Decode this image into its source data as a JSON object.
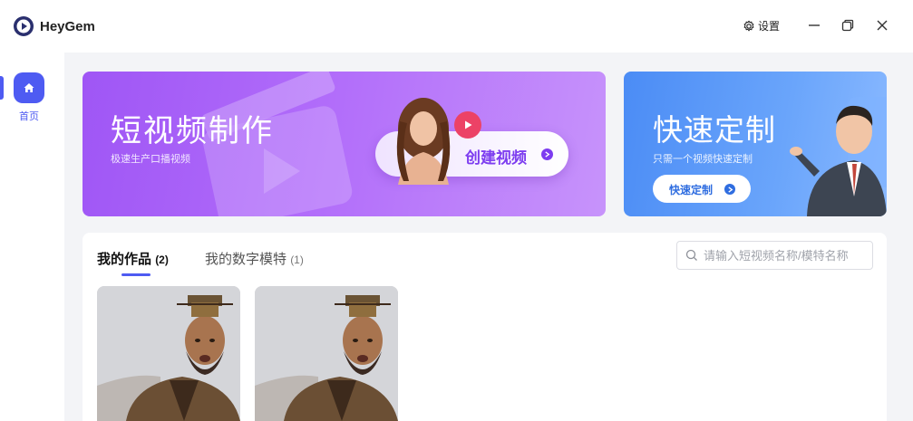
{
  "app": {
    "name": "HeyGem"
  },
  "titlebar": {
    "settings_label": "设置"
  },
  "sidebar": {
    "items": [
      {
        "label": "首页",
        "icon": "home-icon",
        "active": true
      }
    ]
  },
  "banners": {
    "left": {
      "title": "短视频制作",
      "subtitle": "极速生产口播视频",
      "button_label": "创建视频"
    },
    "right": {
      "title": "快速定制",
      "subtitle": "只需一个视频快速定制",
      "button_label": "快速定制"
    }
  },
  "works": {
    "tabs": [
      {
        "label": "我的作品",
        "count": "(2)",
        "active": true
      },
      {
        "label": "我的数字模特",
        "count": "(1)",
        "active": false
      }
    ],
    "search": {
      "placeholder": "请输入短视频名称/模特名称",
      "value": ""
    },
    "cards": [
      {
        "thumbnail": "video-thumbnail"
      },
      {
        "thumbnail": "video-thumbnail"
      }
    ]
  },
  "colors": {
    "accent": "#4e5bf2",
    "purple_banner": "#a95ef8",
    "blue_banner": "#5b97f8",
    "create_text": "#7d3df0"
  }
}
